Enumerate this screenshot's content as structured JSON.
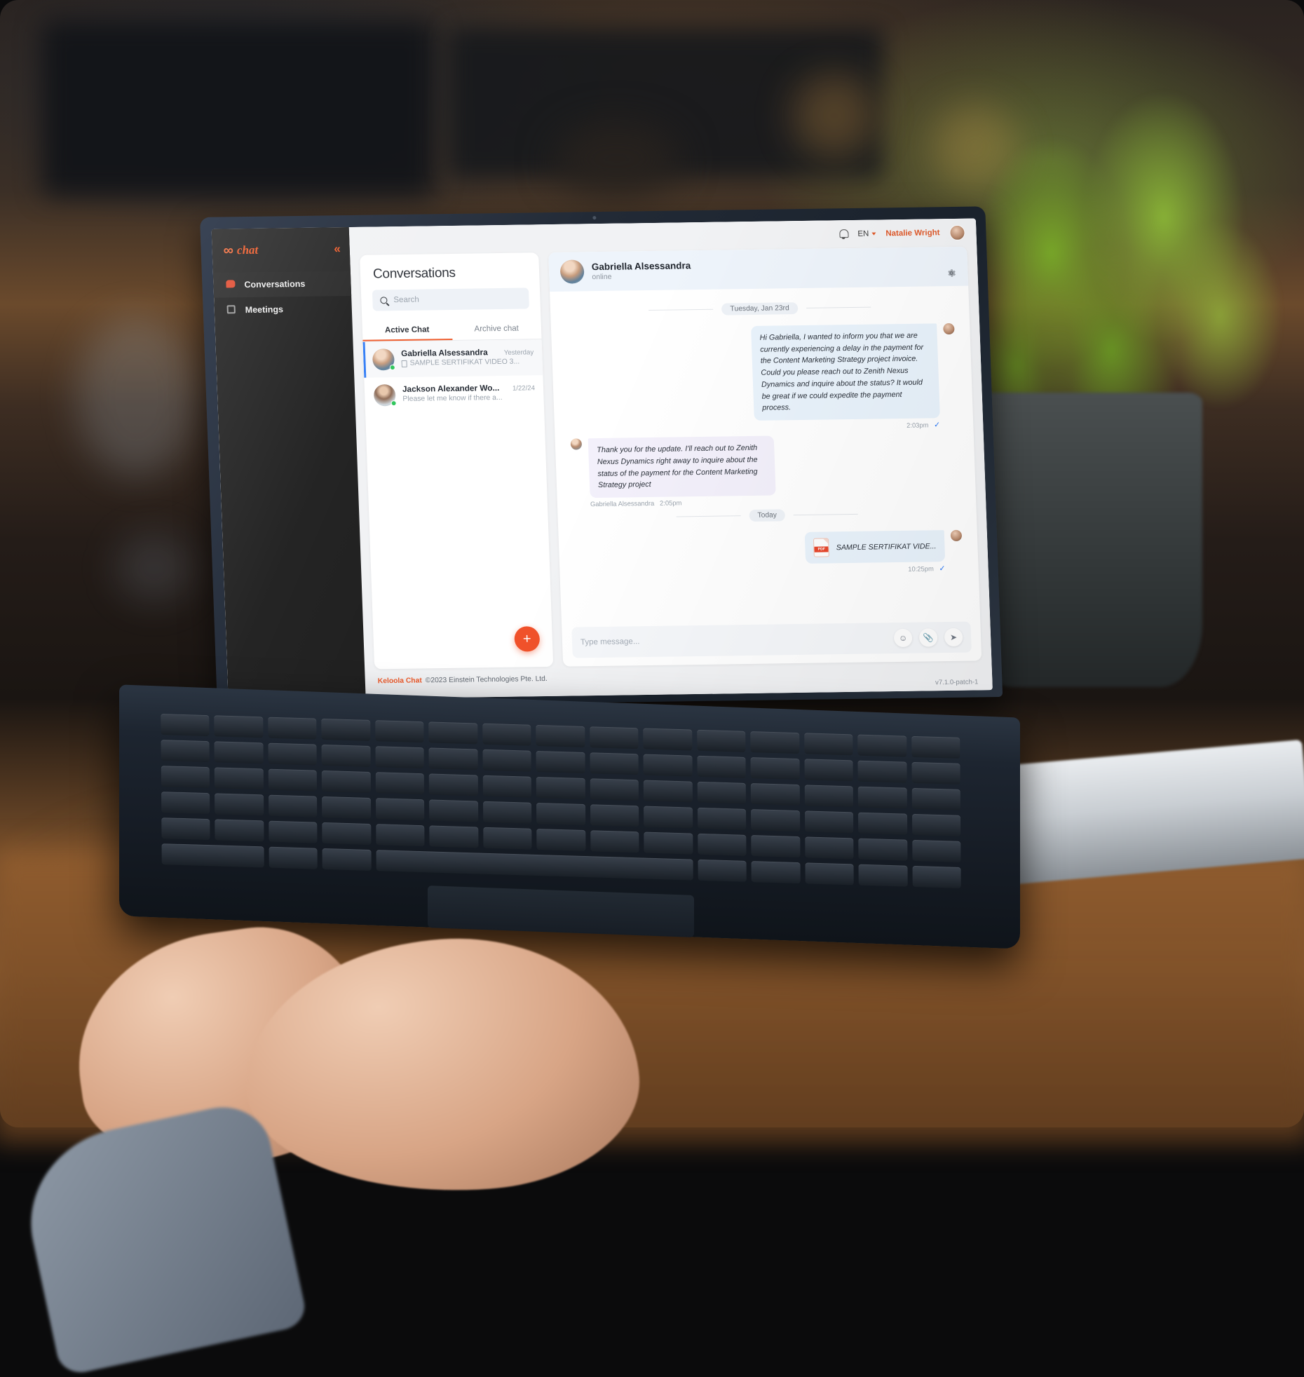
{
  "sidebar": {
    "brand": {
      "mark": "∞",
      "name": "chat"
    },
    "collapse_icon": "«",
    "items": [
      {
        "label": "Conversations",
        "icon": "chat-bubble-icon"
      },
      {
        "label": "Meetings",
        "icon": "calendar-icon"
      }
    ]
  },
  "topbar": {
    "notifications_icon": "bell-icon",
    "language": "EN",
    "user_name": "Natalie Wright"
  },
  "conversations": {
    "title": "Conversations",
    "search": {
      "value": "",
      "placeholder": "Search"
    },
    "tabs": [
      {
        "label": "Active Chat",
        "active": true
      },
      {
        "label": "Archive chat",
        "active": false
      }
    ],
    "items": [
      {
        "name": "Gabriella Alsessandra",
        "preview": "SAMPLE SERTIFIKAT VIDEO 3...",
        "time": "Yesterday",
        "has_attachment": true,
        "online": true,
        "selected": true
      },
      {
        "name": "Jackson Alexander Wo...",
        "preview": "Please let me know if there a...",
        "time": "1/22/24",
        "has_attachment": false,
        "online": true,
        "selected": false
      }
    ],
    "new_chat_button": "+"
  },
  "chat": {
    "header": {
      "name": "Gabriella Alsessandra",
      "status": "online",
      "settings_icon": "gear-icon"
    },
    "dividers": {
      "first": "Tuesday, Jan 23rd",
      "second": "Today"
    },
    "messages": [
      {
        "direction": "out",
        "text": "Hi Gabriella, I wanted to inform you that we are currently experiencing a delay in the payment for the Content Marketing Strategy project invoice. Could you please reach out to Zenith Nexus Dynamics and inquire about the status? It would be great if we could expedite the payment process.",
        "time": "2:03pm",
        "read_tick": "✓"
      },
      {
        "direction": "in",
        "text": "Thank you for the update. I'll reach out to Zenith Nexus Dynamics right away to inquire about the status of the payment for the Content Marketing Strategy project",
        "sender": "Gabriella Alsessandra",
        "time": "2:05pm"
      }
    ],
    "attachment_message": {
      "direction": "out",
      "filename": "SAMPLE SERTIFIKAT VIDE...",
      "file_type": "PDF",
      "time": "10:25pm",
      "read_tick": "✓"
    },
    "composer": {
      "value": "",
      "placeholder": "Type message...",
      "emoji_icon": "emoji-icon",
      "attach_icon": "paperclip-icon",
      "send_icon": "send-icon"
    }
  },
  "footer": {
    "brand": "Keloola Chat",
    "copyright": "©2023 Einstein Technologies Pte. Ltd.",
    "version": "v7.1.0-patch-1"
  },
  "colors": {
    "accent": "#ef5a2a",
    "brand_orange": "#f05a28",
    "online_green": "#2cc55a",
    "tick_blue": "#2f7bf6",
    "out_bubble": "#e9f3fc",
    "in_bubble": "#f3f0fb"
  }
}
